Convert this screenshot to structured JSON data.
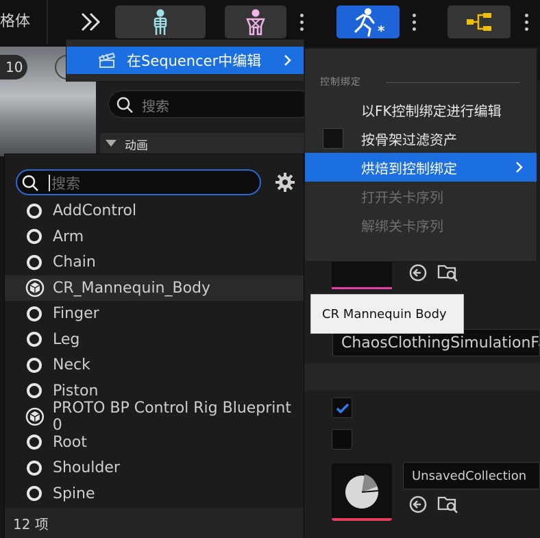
{
  "toolbar": {
    "left_label": "格体",
    "buttons": [
      {
        "icon": "double-chevron-icon"
      },
      {
        "icon": "skeleton-icon"
      },
      {
        "icon": "physics-body-icon"
      },
      {
        "icon": "animation-run-icon"
      },
      {
        "icon": "hierarchy-icon"
      }
    ]
  },
  "viewport": {
    "counter": "10"
  },
  "background": {
    "search_placeholder": "搜索",
    "section_animation": "动画",
    "mesh_field": "ChaosClothingSimulationFa",
    "collection_field": "UnsavedCollection"
  },
  "sequencer_menu": {
    "label": "在Sequencer中编辑"
  },
  "control_menu": {
    "header": "控制绑定",
    "items": [
      {
        "label": "以FK控制绑定进行编辑",
        "state": "enabled"
      },
      {
        "label": "按骨架过滤资产",
        "state": "checkbox"
      },
      {
        "label": "烘焙到控制绑定",
        "state": "highlighted"
      },
      {
        "label": "打开关卡序列",
        "state": "disabled"
      },
      {
        "label": "解绑关卡序列",
        "state": "disabled"
      }
    ]
  },
  "picker": {
    "search_placeholder": "搜索",
    "items": [
      {
        "label": "AddControl",
        "icon": "ring"
      },
      {
        "label": "Arm",
        "icon": "ring"
      },
      {
        "label": "Chain",
        "icon": "ring"
      },
      {
        "label": "CR_Mannequin_Body",
        "icon": "cube"
      },
      {
        "label": "Finger",
        "icon": "ring"
      },
      {
        "label": "Leg",
        "icon": "ring"
      },
      {
        "label": "Neck",
        "icon": "ring"
      },
      {
        "label": "Piston",
        "icon": "ring"
      },
      {
        "label": "PROTO BP Control Rig Blueprint 0",
        "icon": "cube"
      },
      {
        "label": "Root",
        "icon": "ring"
      },
      {
        "label": "Shoulder",
        "icon": "ring"
      },
      {
        "label": "Spine",
        "icon": "ring"
      }
    ],
    "count": "12 项"
  },
  "tooltip": {
    "text": "CR Mannequin Body"
  },
  "colors": {
    "accent": "#1c6fe0",
    "focus": "#2a6bd6"
  }
}
